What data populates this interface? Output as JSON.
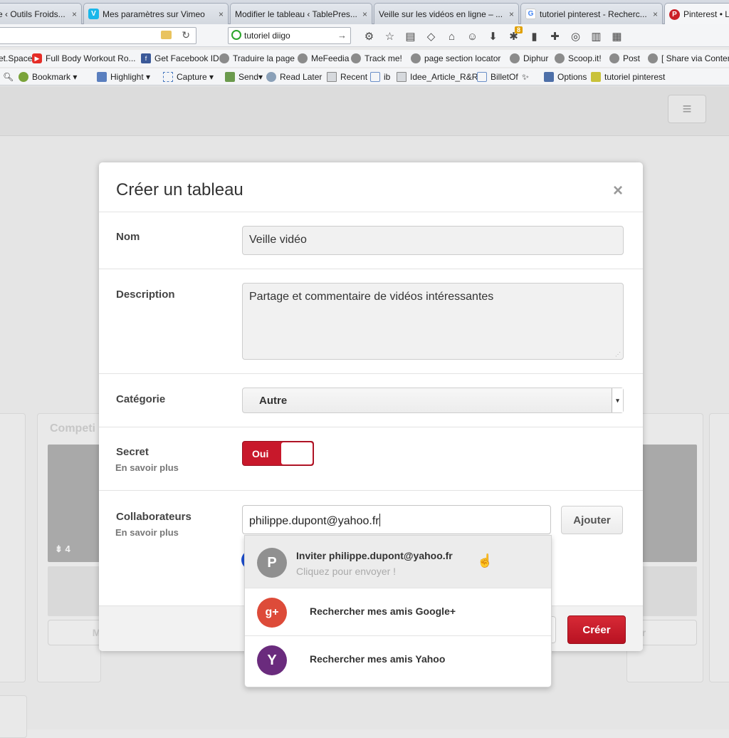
{
  "tabs": [
    {
      "label": "e ‹ Outils Froids...",
      "favicon": "",
      "active": false
    },
    {
      "label": "Mes paramètres sur Vimeo",
      "favicon": "V",
      "favcolor": "#1ab7ea",
      "active": false
    },
    {
      "label": "Modifier le tableau ‹ TablePres...",
      "favicon": "",
      "active": false
    },
    {
      "label": "Veille sur les vidéos en ligne – ...",
      "favicon": "",
      "active": false
    },
    {
      "label": "tutoriel pinterest - Recherc...",
      "favicon": "G",
      "favcolor": "#4285f4",
      "active": false
    },
    {
      "label": "Pinterest • L",
      "favicon": "P",
      "favcolor": "#cb2027",
      "active": true
    }
  ],
  "tab_close": "×",
  "searchbar": {
    "value": "tutoriel diigo"
  },
  "bookmarks1": [
    {
      "label": "et.Space"
    },
    {
      "label": "Full Body Workout Ro..."
    },
    {
      "label": "Get Facebook ID"
    },
    {
      "label": "Traduire la page"
    },
    {
      "label": "MeFeedia"
    },
    {
      "label": "Track me!"
    },
    {
      "label": "page section locator"
    },
    {
      "label": "Diphur"
    },
    {
      "label": "Scoop.it!"
    },
    {
      "label": "Post"
    },
    {
      "label": "[ Share via Conten"
    }
  ],
  "bookmarks2": [
    {
      "label": "Bookmark"
    },
    {
      "label": "Highlight"
    },
    {
      "label": "Capture"
    },
    {
      "label": "Send"
    },
    {
      "label": "Read Later"
    },
    {
      "label": "Recent"
    },
    {
      "label": "ib"
    },
    {
      "label": "Idee_Article_R&R"
    },
    {
      "label": "BilletOf"
    },
    {
      "label": "Options"
    },
    {
      "label": "tutoriel  pinterest"
    }
  ],
  "badge_count": "8",
  "background": {
    "board_title": "Competi",
    "pin_count": "4",
    "modify_label": "Modifier"
  },
  "modal": {
    "title": "Créer un tableau",
    "close": "×",
    "name_label": "Nom",
    "name_value": "Veille vidéo",
    "description_label": "Description",
    "description_value": "Partage et commentaire de vidéos intéressantes",
    "category_label": "Catégorie",
    "category_value": "Autre",
    "secret_label": "Secret",
    "secret_more": "En savoir plus",
    "secret_toggle": "Oui",
    "collab_label": "Collaborateurs",
    "collab_more": "En savoir plus",
    "collab_value": "philippe.dupont@yahoo.fr",
    "add_button": "Ajouter",
    "create_button": "Créer"
  },
  "dropdown": {
    "invite_avatar": "P",
    "invite_main": "Inviter philippe.dupont@yahoo.fr",
    "invite_sub": "Cliquez pour envoyer !",
    "google_avatar": "g+",
    "google_label": "Rechercher mes amis Google+",
    "yahoo_avatar": "Y",
    "yahoo_label": "Rechercher mes amis Yahoo"
  },
  "colors": {
    "pinterest_red": "#c8182b",
    "google_red": "#dd4b39",
    "yahoo_purple": "#6a2b7d"
  }
}
